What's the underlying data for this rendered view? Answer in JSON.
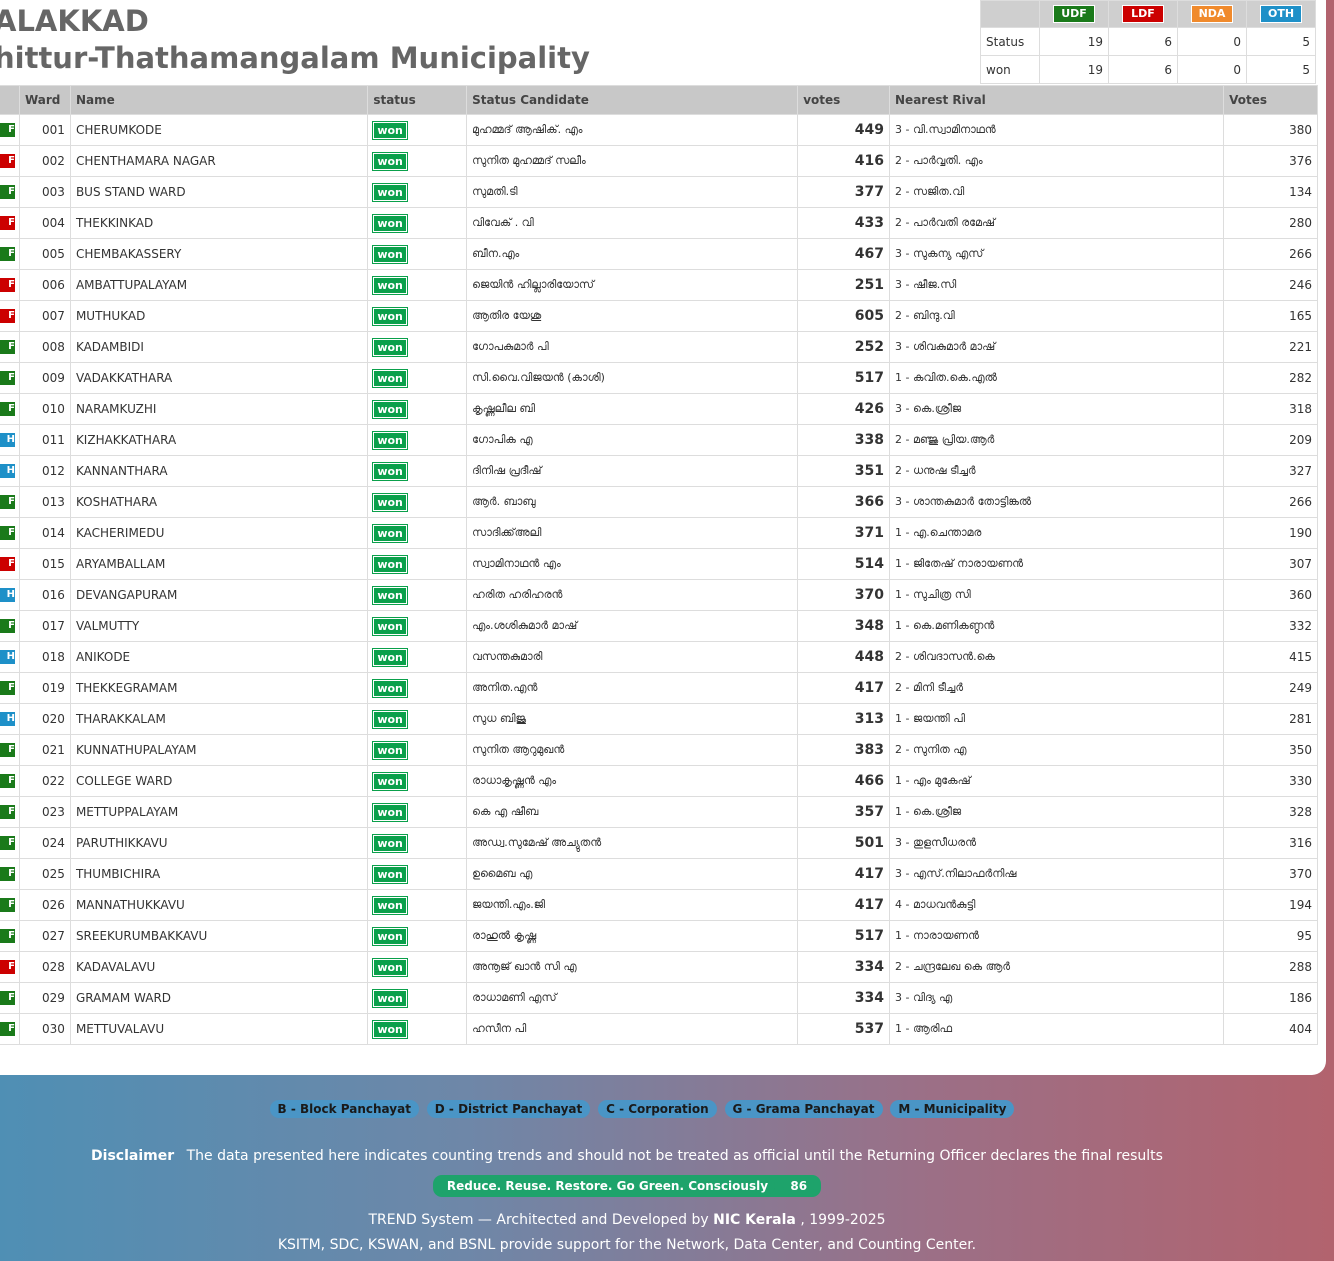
{
  "header": {
    "district": "ALAKKAD",
    "local_body": "hittur-Thathamangalam Municipality"
  },
  "summary": {
    "parties": [
      {
        "label": "UDF",
        "color": "#1a7a1a"
      },
      {
        "label": "LDF",
        "color": "#cc0000"
      },
      {
        "label": "NDA",
        "color": "#f08a2c"
      },
      {
        "label": "OTH",
        "color": "#1e90c8"
      }
    ],
    "rows": [
      {
        "label": "Status",
        "values": [
          "19",
          "6",
          "0",
          "5"
        ]
      },
      {
        "label": "won",
        "values": [
          "19",
          "6",
          "0",
          "5"
        ]
      }
    ]
  },
  "table": {
    "headers": [
      "Ward",
      "Name",
      "status",
      "Status Candidate",
      "votes",
      "Nearest Rival",
      "Votes"
    ],
    "rows": [
      {
        "party": "F",
        "color": "#1a7a1a",
        "ward": "001",
        "name": "CHERUMKODE",
        "status": "won",
        "candidate": "മുഹമ്മദ് ആഷിക്. എം",
        "votes": "449",
        "rival": "3 - വി.സ്വാമിനാഥൻ",
        "rvotes": "380"
      },
      {
        "party": "F",
        "color": "#cc0000",
        "ward": "002",
        "name": "CHENTHAMARA NAGAR",
        "status": "won",
        "candidate": "സുനിത മുഹമ്മദ് സലീം",
        "votes": "416",
        "rival": "2 - പാർവ്വതി. എം",
        "rvotes": "376"
      },
      {
        "party": "F",
        "color": "#1a7a1a",
        "ward": "003",
        "name": "BUS STAND WARD",
        "status": "won",
        "candidate": "സുമതി.ടി",
        "votes": "377",
        "rival": "2 - സജിത.വി",
        "rvotes": "134"
      },
      {
        "party": "F",
        "color": "#cc0000",
        "ward": "004",
        "name": "THEKKINKAD",
        "status": "won",
        "candidate": "വിവേക് . വി",
        "votes": "433",
        "rival": "2 - പാർവതി രമേഷ്",
        "rvotes": "280"
      },
      {
        "party": "F",
        "color": "#1a7a1a",
        "ward": "005",
        "name": "CHEMBAKASSERY",
        "status": "won",
        "candidate": "ബീന.എം",
        "votes": "467",
        "rival": "3 - സുകന്യ എസ്",
        "rvotes": "266"
      },
      {
        "party": "F",
        "color": "#cc0000",
        "ward": "006",
        "name": "AMBATTUPALAYAM",
        "status": "won",
        "candidate": "ജെയിൻ ഹില്ലാരിയോസ്",
        "votes": "251",
        "rival": "3 - ഷീജ.സി",
        "rvotes": "246"
      },
      {
        "party": "F",
        "color": "#cc0000",
        "ward": "007",
        "name": "MUTHUKAD",
        "status": "won",
        "candidate": "ആതിര യേശു",
        "votes": "605",
        "rival": "2 - ബിന്ദു.വി",
        "rvotes": "165"
      },
      {
        "party": "F",
        "color": "#1a7a1a",
        "ward": "008",
        "name": "KADAMBIDI",
        "status": "won",
        "candidate": "ഗോപകുമാർ പി",
        "votes": "252",
        "rival": "3 - ശിവകുമാർ മാഷ്",
        "rvotes": "221"
      },
      {
        "party": "F",
        "color": "#1a7a1a",
        "ward": "009",
        "name": "VADAKKATHARA",
        "status": "won",
        "candidate": "സി.വൈ.വിജയൻ (കാശി)",
        "votes": "517",
        "rival": "1 - കവിത.കെ.എൽ",
        "rvotes": "282"
      },
      {
        "party": "F",
        "color": "#1a7a1a",
        "ward": "010",
        "name": "NARAMKUZHI",
        "status": "won",
        "candidate": "കൃഷ്ണലീല ബി",
        "votes": "426",
        "rival": "3 - കെ.ശ്രീജ",
        "rvotes": "318"
      },
      {
        "party": "H",
        "color": "#1e90c8",
        "ward": "011",
        "name": "KIZHAKKATHARA",
        "status": "won",
        "candidate": "ഗോപിക എ",
        "votes": "338",
        "rival": "2 - മഞ്ജു പ്രിയ.ആർ",
        "rvotes": "209"
      },
      {
        "party": "H",
        "color": "#1e90c8",
        "ward": "012",
        "name": "KANNANTHARA",
        "status": "won",
        "candidate": "ദിനിഷ പ്രദീഷ്",
        "votes": "351",
        "rival": "2 - ധനുഷ ടീച്ചർ",
        "rvotes": "327"
      },
      {
        "party": "F",
        "color": "#1a7a1a",
        "ward": "013",
        "name": "KOSHATHARA",
        "status": "won",
        "candidate": "ആർ. ബാബു",
        "votes": "366",
        "rival": "3 - ശാന്തകുമാർ തോട്ടിങ്കൽ",
        "rvotes": "266"
      },
      {
        "party": "F",
        "color": "#1a7a1a",
        "ward": "014",
        "name": "KACHERIMEDU",
        "status": "won",
        "candidate": "സാദിക്ക്അലി",
        "votes": "371",
        "rival": "1 - എ.ചെന്താമര",
        "rvotes": "190"
      },
      {
        "party": "F",
        "color": "#cc0000",
        "ward": "015",
        "name": "ARYAMBALLAM",
        "status": "won",
        "candidate": "സ്വാമിനാഥൻ എം",
        "votes": "514",
        "rival": "1 - ജിതേഷ് നാരായണൻ",
        "rvotes": "307"
      },
      {
        "party": "H",
        "color": "#1e90c8",
        "ward": "016",
        "name": "DEVANGAPURAM",
        "status": "won",
        "candidate": "ഹരിത ഹരിഹരൻ",
        "votes": "370",
        "rival": "1 - സുചിത്ര സി",
        "rvotes": "360"
      },
      {
        "party": "F",
        "color": "#1a7a1a",
        "ward": "017",
        "name": "VALMUTTY",
        "status": "won",
        "candidate": "എം.ശശികുമാർ മാഷ്",
        "votes": "348",
        "rival": "1 - കെ.മണികണ്ഠൻ",
        "rvotes": "332"
      },
      {
        "party": "H",
        "color": "#1e90c8",
        "ward": "018",
        "name": "ANIKODE",
        "status": "won",
        "candidate": "വസന്തകുമാരി",
        "votes": "448",
        "rival": "2 - ശിവദാസൻ.കെ",
        "rvotes": "415"
      },
      {
        "party": "F",
        "color": "#1a7a1a",
        "ward": "019",
        "name": "THEKKEGRAMAM",
        "status": "won",
        "candidate": "അനിത.എൻ",
        "votes": "417",
        "rival": "2 - മിനി ടീച്ചർ",
        "rvotes": "249"
      },
      {
        "party": "H",
        "color": "#1e90c8",
        "ward": "020",
        "name": "THARAKKALAM",
        "status": "won",
        "candidate": "സുധ ബിജു",
        "votes": "313",
        "rival": "1 - ജയന്തി പി",
        "rvotes": "281"
      },
      {
        "party": "F",
        "color": "#1a7a1a",
        "ward": "021",
        "name": "KUNNATHUPALAYAM",
        "status": "won",
        "candidate": "സുനിത ആറുമുഖൻ",
        "votes": "383",
        "rival": "2 - സുനിത എ",
        "rvotes": "350"
      },
      {
        "party": "F",
        "color": "#1a7a1a",
        "ward": "022",
        "name": "COLLEGE WARD",
        "status": "won",
        "candidate": "രാധാകൃഷ്ണൻ എം",
        "votes": "466",
        "rival": "1 - എം മുകേഷ്",
        "rvotes": "330"
      },
      {
        "party": "F",
        "color": "#1a7a1a",
        "ward": "023",
        "name": "METTUPPALAYAM",
        "status": "won",
        "candidate": "കെ എ ഷീബ",
        "votes": "357",
        "rival": "1 - കെ.ശ്രീജ",
        "rvotes": "328"
      },
      {
        "party": "F",
        "color": "#1a7a1a",
        "ward": "024",
        "name": "PARUTHIKKAVU",
        "status": "won",
        "candidate": "അഡ്വ.സുമേഷ് അച്യുതൻ",
        "votes": "501",
        "rival": "3 - തുളസീധരൻ",
        "rvotes": "316"
      },
      {
        "party": "F",
        "color": "#1a7a1a",
        "ward": "025",
        "name": "THUMBICHIRA",
        "status": "won",
        "candidate": "ഉമൈബ എ",
        "votes": "417",
        "rival": "3 - എസ്.നിലാഫർനിഷ",
        "rvotes": "370"
      },
      {
        "party": "F",
        "color": "#1a7a1a",
        "ward": "026",
        "name": "MANNATHUKKAVU",
        "status": "won",
        "candidate": "ജയന്തി.എം.ജി",
        "votes": "417",
        "rival": "4 - മാധവൻകുട്ടി",
        "rvotes": "194"
      },
      {
        "party": "F",
        "color": "#1a7a1a",
        "ward": "027",
        "name": "SREEKURUMBAKKAVU",
        "status": "won",
        "candidate": "രാഹുൽ കൃഷ്ണ",
        "votes": "517",
        "rival": "1 - നാരായണൻ",
        "rvotes": "95"
      },
      {
        "party": "F",
        "color": "#cc0000",
        "ward": "028",
        "name": "KADAVALAVU",
        "status": "won",
        "candidate": "അനൂജ് ഖാൻ സി എ",
        "votes": "334",
        "rival": "2 - ചന്ദ്രലേഖ കെ ആർ",
        "rvotes": "288"
      },
      {
        "party": "F",
        "color": "#1a7a1a",
        "ward": "029",
        "name": "GRAMAM WARD",
        "status": "won",
        "candidate": "രാധാമണി എസ്",
        "votes": "334",
        "rival": "3 - വിദ്യ എ",
        "rvotes": "186"
      },
      {
        "party": "F",
        "color": "#1a7a1a",
        "ward": "030",
        "name": "METTUVALAVU",
        "status": "won",
        "candidate": "ഹസീന പി",
        "votes": "537",
        "rival": "1 - ആരിഫ",
        "rvotes": "404"
      }
    ]
  },
  "footer": {
    "legend": [
      "B - Block Panchayat",
      "D - District Panchayat",
      "C - Corporation",
      "G - Grama Panchayat",
      "M - Municipality"
    ],
    "disclaimer_label": "Disclaimer",
    "disclaimer_text": "The data presented here indicates counting trends and should not be treated as official until the Returning Officer declares the final results",
    "green_text": "Reduce. Reuse. Restore. Go Green. Consciously",
    "green_count": "86",
    "credit_prefix": "TREND System — Architected and Developed by",
    "credit_org": "NIC Kerala",
    "credit_suffix": ", 1999-2025",
    "support": "KSITM, SDC, KSWAN, and BSNL provide support for the Network, Data Center, and Counting Center."
  }
}
